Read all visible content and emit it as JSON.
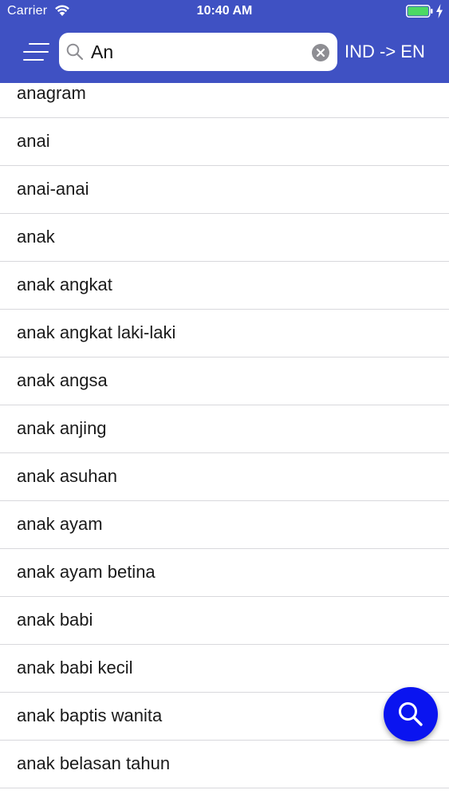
{
  "status_bar": {
    "carrier": "Carrier",
    "time": "10:40 AM"
  },
  "header": {
    "menu_icon": "hamburger-menu-icon",
    "search": {
      "value": "An",
      "icon": "search-icon",
      "clear_icon": "clear-icon"
    },
    "language_toggle": "IND -> EN"
  },
  "words": [
    "anagram",
    "anai",
    "anai-anai",
    "anak",
    "anak angkat",
    "anak angkat laki-laki",
    "anak angsa",
    "anak anjing",
    "anak asuhan",
    "anak ayam",
    "anak ayam betina",
    "anak babi",
    "anak babi kecil",
    "anak baptis wanita",
    "anak belasan tahun"
  ],
  "fab": {
    "icon": "search-icon"
  },
  "colors": {
    "header_background": "#3f51c3",
    "fab_background": "#0a14f0",
    "battery": "#4cd964"
  }
}
